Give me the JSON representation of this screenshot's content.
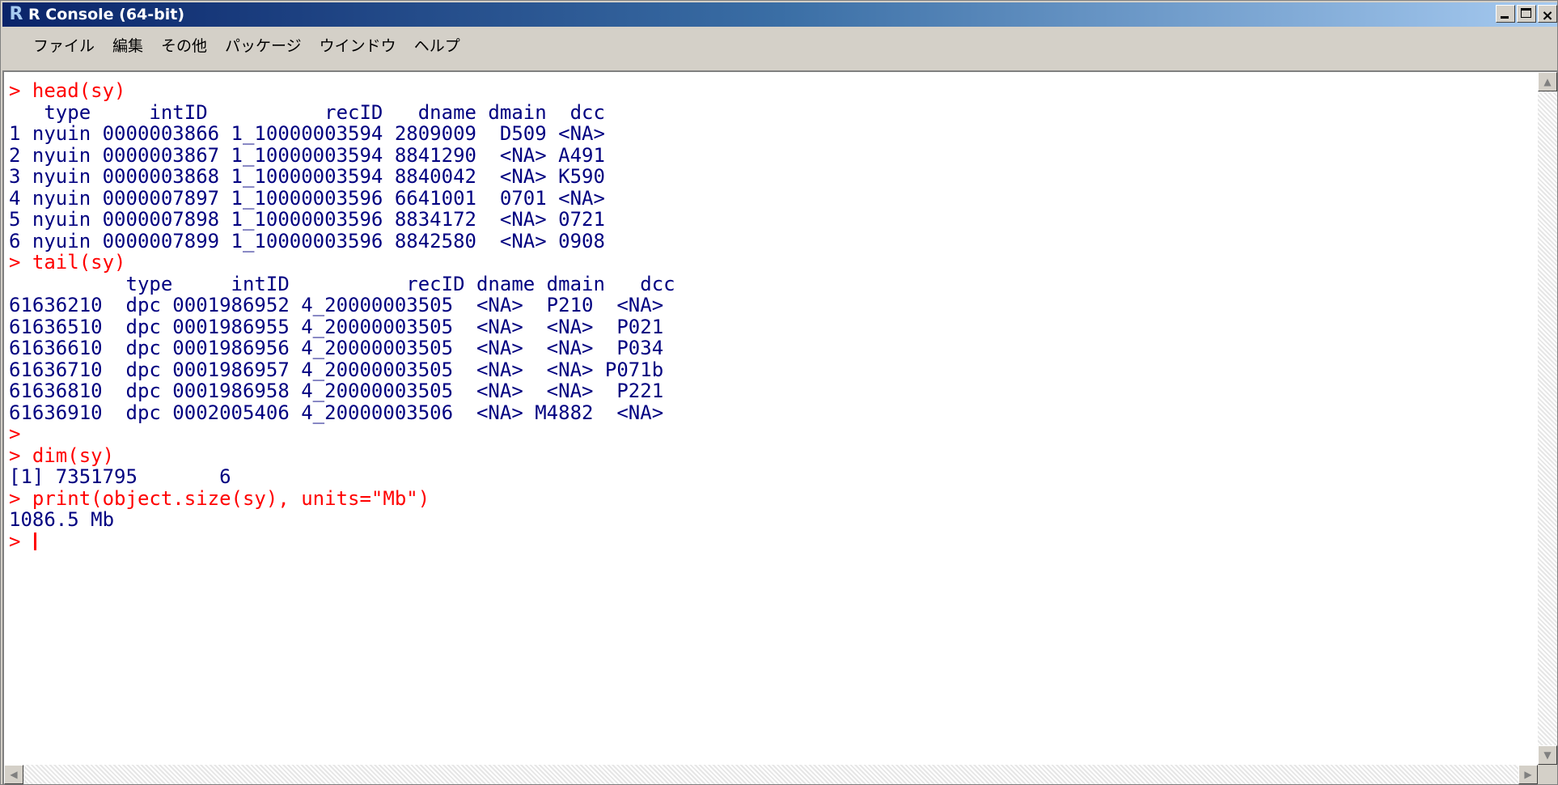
{
  "window": {
    "title": "R Console (64-bit)",
    "icon": "r-logo-icon"
  },
  "menu": {
    "items": [
      "ファイル",
      "編集",
      "その他",
      "パッケージ",
      "ウインドウ",
      "ヘルプ"
    ]
  },
  "console": {
    "lines": [
      {
        "kind": "in",
        "text": "> head(sy)"
      },
      {
        "kind": "out",
        "text": "   type     intID          recID   dname dmain  dcc"
      },
      {
        "kind": "out",
        "text": "1 nyuin 0000003866 1_10000003594 2809009  D509 <NA>"
      },
      {
        "kind": "out",
        "text": "2 nyuin 0000003867 1_10000003594 8841290  <NA> A491"
      },
      {
        "kind": "out",
        "text": "3 nyuin 0000003868 1_10000003594 8840042  <NA> K590"
      },
      {
        "kind": "out",
        "text": "4 nyuin 0000007897 1_10000003596 6641001  0701 <NA>"
      },
      {
        "kind": "out",
        "text": "5 nyuin 0000007898 1_10000003596 8834172  <NA> 0721"
      },
      {
        "kind": "out",
        "text": "6 nyuin 0000007899 1_10000003596 8842580  <NA> 0908"
      },
      {
        "kind": "in",
        "text": "> tail(sy)"
      },
      {
        "kind": "out",
        "text": "          type     intID          recID dname dmain   dcc"
      },
      {
        "kind": "out",
        "text": "61636210  dpc 0001986952 4_20000003505  <NA>  P210  <NA>"
      },
      {
        "kind": "out",
        "text": "61636510  dpc 0001986955 4_20000003505  <NA>  <NA>  P021"
      },
      {
        "kind": "out",
        "text": "61636610  dpc 0001986956 4_20000003505  <NA>  <NA>  P034"
      },
      {
        "kind": "out",
        "text": "61636710  dpc 0001986957 4_20000003505  <NA>  <NA> P071b"
      },
      {
        "kind": "out",
        "text": "61636810  dpc 0001986958 4_20000003505  <NA>  <NA>  P221"
      },
      {
        "kind": "out",
        "text": "61636910  dpc 0002005406 4_20000003506  <NA> M4882  <NA>"
      },
      {
        "kind": "in",
        "text": ">"
      },
      {
        "kind": "in",
        "text": "> dim(sy)"
      },
      {
        "kind": "out",
        "text": "[1] 7351795       6"
      },
      {
        "kind": "in",
        "text": "> print(object.size(sy), units=\"Mb\")"
      },
      {
        "kind": "out",
        "text": "1086.5 Mb"
      }
    ],
    "prompt": "> "
  },
  "colors": {
    "input": "#ff0000",
    "output": "#000080",
    "titlebar_start": "#0a246a",
    "titlebar_end": "#a6caf0"
  }
}
